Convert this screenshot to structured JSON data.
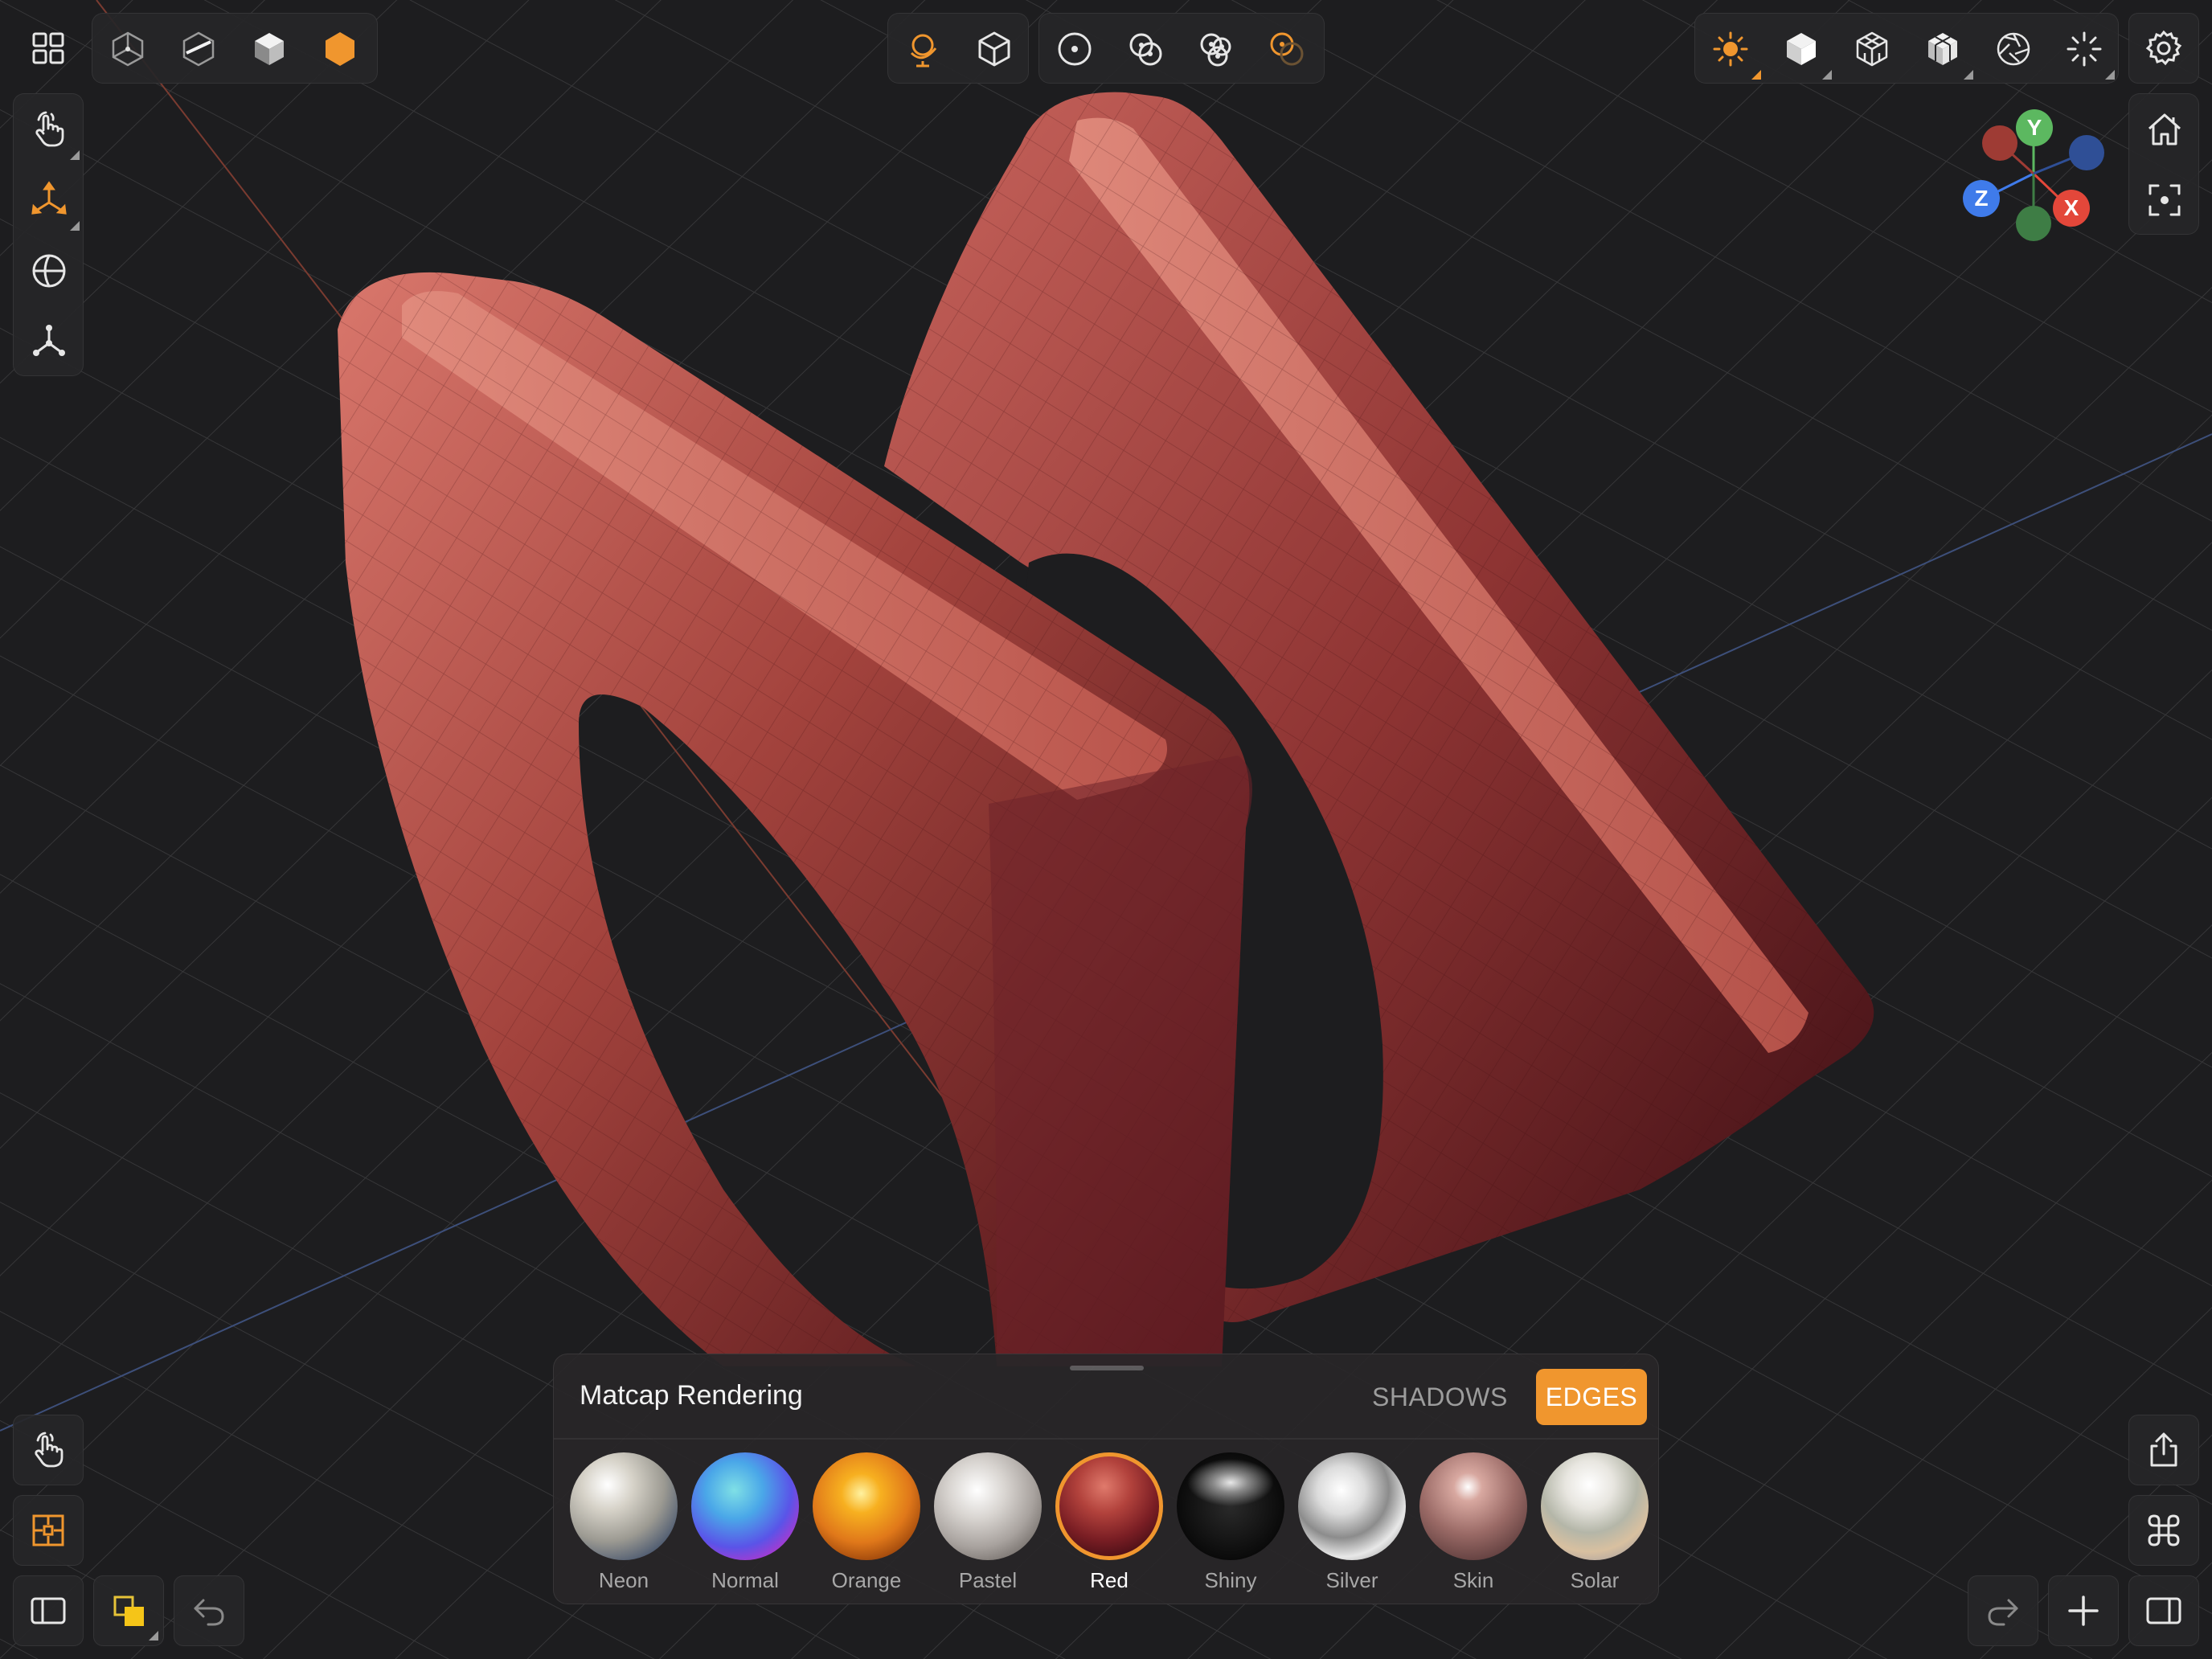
{
  "colors": {
    "accent": "#f0962e",
    "background": "#1d1d1f",
    "model": "#9a3c38",
    "axis_x": "#e3473a",
    "axis_y": "#5cb860",
    "axis_z": "#3f7bea"
  },
  "top_left_toolbar": {
    "menu_icon": "grid-menu-icon",
    "items": [
      "wireframe-cube-icon",
      "section-cube-icon",
      "solid-cube-icon",
      "hexagon-icon"
    ]
  },
  "top_center_toolbar": {
    "group1": [
      "orbit-globe-icon",
      "cube-outline-icon"
    ],
    "group2": [
      "single-circle-icon",
      "two-circles-icon",
      "three-circles-icon",
      "orange-circles-icon"
    ]
  },
  "top_right_toolbar": {
    "items": [
      "sun-icon",
      "shaded-cube-icon",
      "wire-cube-icon",
      "textured-cube-icon",
      "aperture-icon",
      "sparkle-icon"
    ],
    "settings": "gear-icon"
  },
  "left_toolbar": [
    "touch-hand-icon",
    "move-gizmo-icon",
    "sphere-grid-icon",
    "pivot-icon"
  ],
  "view_cube": {
    "axes": {
      "x": "X",
      "y": "Y",
      "z": "Z"
    }
  },
  "right_buttons": [
    "home-icon",
    "focus-icon"
  ],
  "bottom_left": [
    "touch-hand-icon",
    "snap-grid-icon",
    "sidebar-icon",
    "layers-icon",
    "undo-icon"
  ],
  "bottom_right": [
    "share-icon",
    "command-icon",
    "redo-icon",
    "plus-icon",
    "sidebar-right-icon"
  ],
  "matcap": {
    "title": "Matcap Rendering",
    "shadows_label": "SHADOWS",
    "edges_label": "EDGES",
    "selected": "Red",
    "swatches": [
      {
        "name": "Neon"
      },
      {
        "name": "Normal"
      },
      {
        "name": "Orange"
      },
      {
        "name": "Pastel"
      },
      {
        "name": "Red"
      },
      {
        "name": "Shiny"
      },
      {
        "name": "Silver"
      },
      {
        "name": "Skin"
      },
      {
        "name": "Solar"
      }
    ]
  }
}
